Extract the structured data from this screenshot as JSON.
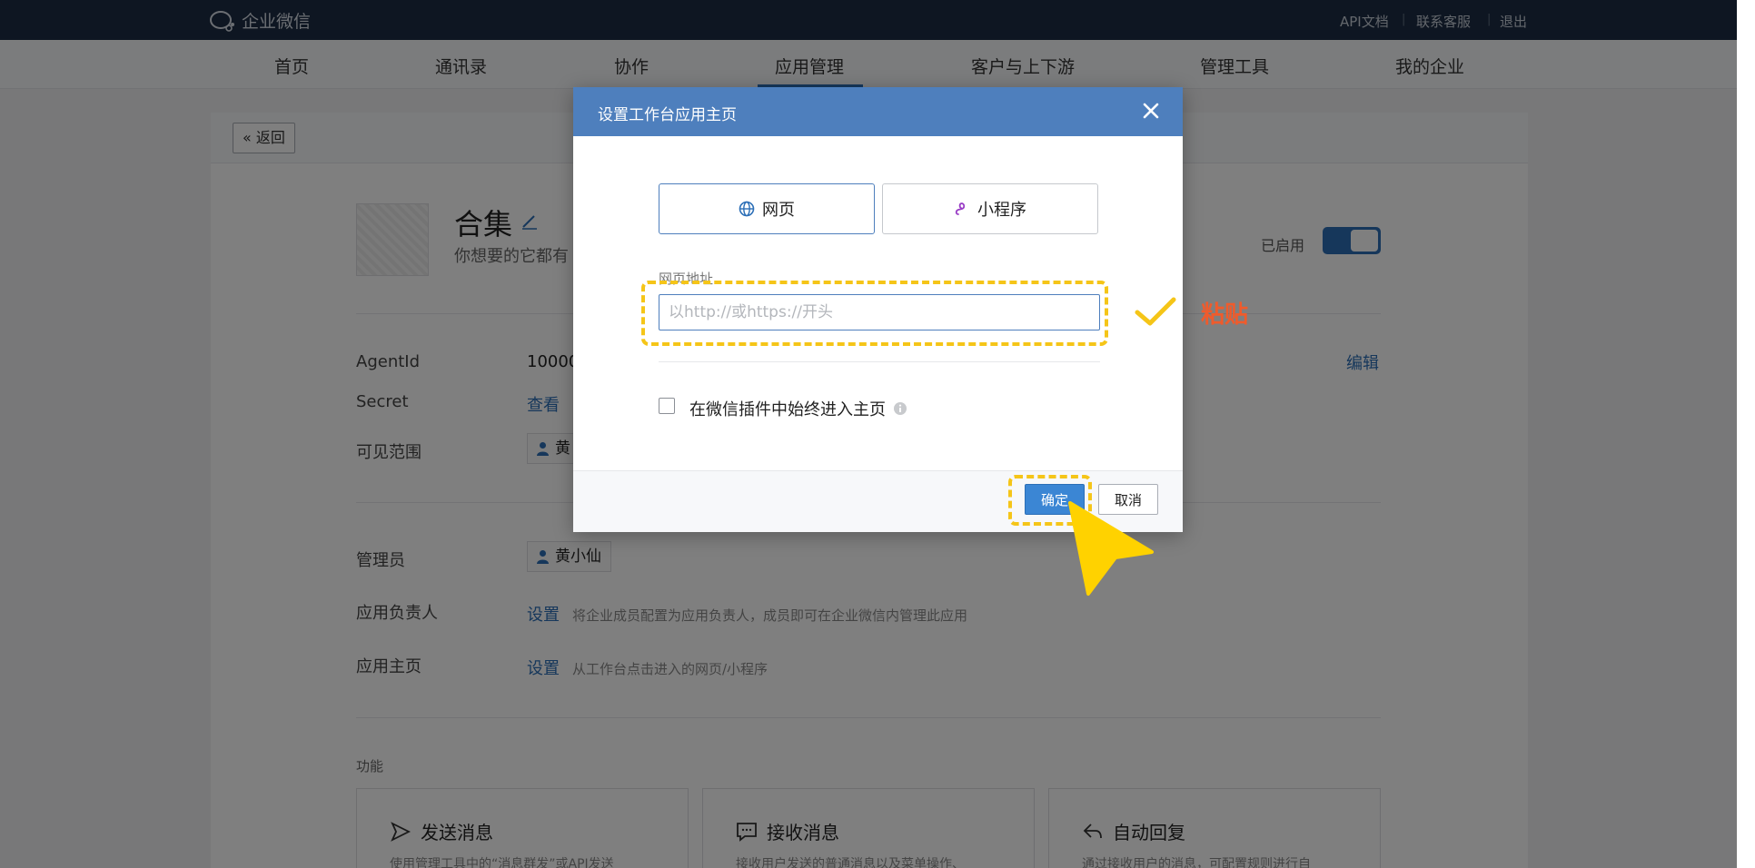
{
  "topbar": {
    "logo_text": "企业微信",
    "links": [
      "API文档",
      "联系客服",
      "退出"
    ]
  },
  "nav": {
    "items": [
      "首页",
      "通讯录",
      "协作",
      "应用管理",
      "客户与上下游",
      "管理工具",
      "我的企业"
    ],
    "active": "应用管理"
  },
  "page": {
    "back_label": "« 返回",
    "app_name": "合集",
    "app_desc": "你想要的它都有",
    "enabled_label": "已启用",
    "agentid_label": "AgentId",
    "agentid_value": "10000",
    "secret_label": "Secret",
    "secret_link": "查看",
    "scope_label": "可见范围",
    "scope_value": "黄",
    "edit_link": "编辑",
    "admin_label": "管理员",
    "admin_value": "黄小仙",
    "owner_label": "应用负责人",
    "owner_link": "设置",
    "owner_hint": "将企业成员配置为应用负责人，成员即可在企业微信内管理此应用",
    "home_label": "应用主页",
    "home_link": "设置",
    "home_hint": "从工作台点击进入的网页/小程序",
    "features_title": "功能",
    "cards": [
      {
        "title": "发送消息",
        "desc": "使用管理工具中的“消息群发”或API发送"
      },
      {
        "title": "接收消息",
        "desc": "接收用户发送的普通消息以及菜单操作、"
      },
      {
        "title": "自动回复",
        "desc": "通过接收用户的消息，可配置规则进行自"
      }
    ]
  },
  "modal": {
    "title": "设置工作台应用主页",
    "tab_web": "网页",
    "tab_miniprogram": "小程序",
    "field_label": "网页地址",
    "url_placeholder": "以http://或https://开头",
    "checkbox_label": "在微信插件中始终进入主页",
    "confirm": "确定",
    "cancel": "取消"
  },
  "annotation": {
    "paste_label": "粘贴",
    "highlight_color": "#f5c518",
    "text_color": "#ef5b2c"
  },
  "colors": {
    "topbar": "#1d2d44",
    "accent": "#2c6fb7",
    "modal_header": "#4e7fbd"
  }
}
